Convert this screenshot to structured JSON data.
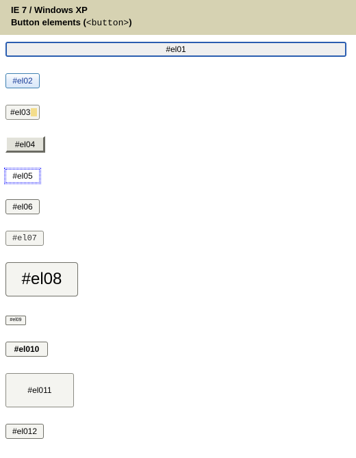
{
  "header": {
    "line1": "IE 7 / Windows XP",
    "line2_prefix": "Button elements (",
    "line2_code": "<button>",
    "line2_suffix": ")"
  },
  "buttons": {
    "el01": "#el01",
    "el02": "#el02",
    "el03": "#el03",
    "el04": "#el04",
    "el05": "#el05",
    "el06": "#el06",
    "el07": "#el07",
    "el08": "#el08",
    "el09": "#el09",
    "el010": "#el010",
    "el011": "#el011",
    "el012": "#el012"
  }
}
